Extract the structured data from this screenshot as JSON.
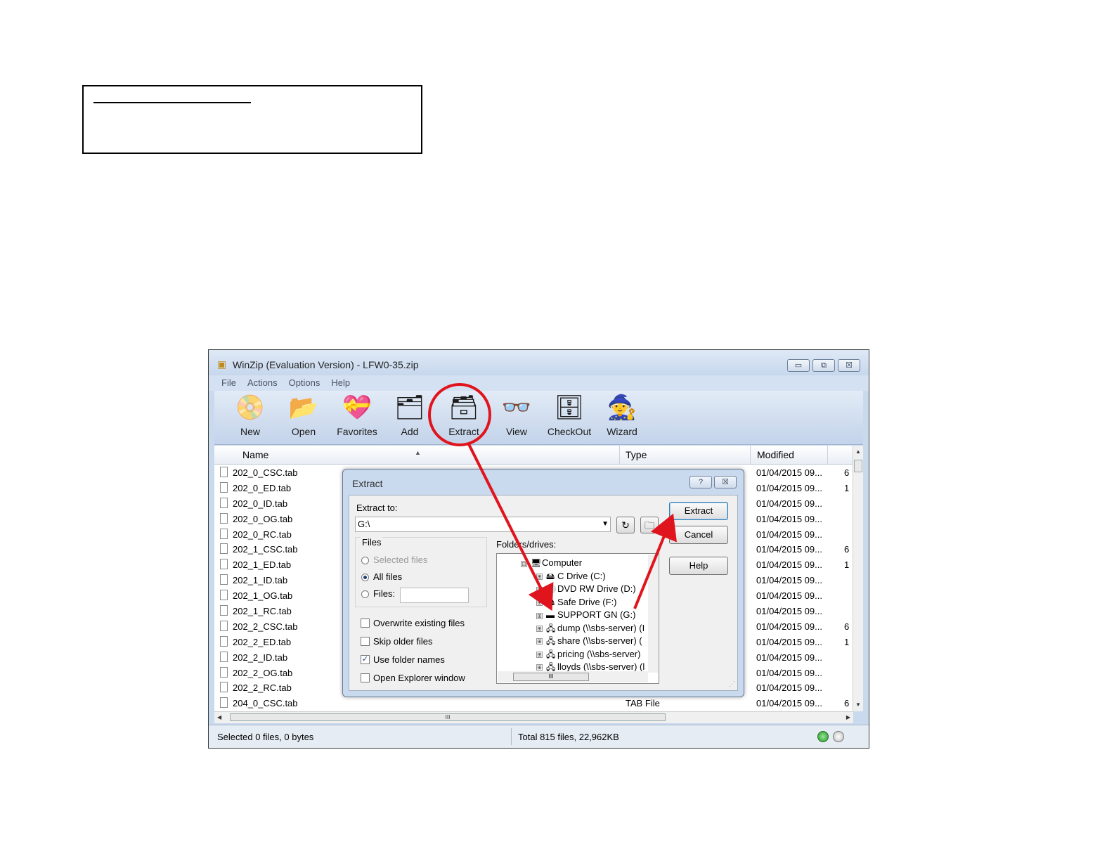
{
  "window": {
    "title": "WinZip (Evaluation Version) - LFW0-35.zip",
    "controls": [
      "▭",
      "⧉",
      "☒"
    ]
  },
  "menu": [
    "File",
    "Actions",
    "Options",
    "Help"
  ],
  "toolbar": [
    {
      "label": "New",
      "icon": "new-archive-icon",
      "glyph": "📀"
    },
    {
      "label": "Open",
      "icon": "open-archive-icon",
      "glyph": "📂"
    },
    {
      "label": "Favorites",
      "icon": "favorites-icon",
      "glyph": "💝"
    },
    {
      "label": "Add",
      "icon": "add-icon",
      "glyph": "🗂"
    },
    {
      "label": "Extract",
      "icon": "extract-icon",
      "glyph": "🗃"
    },
    {
      "label": "View",
      "icon": "view-icon",
      "glyph": "👓"
    },
    {
      "label": "CheckOut",
      "icon": "checkout-icon",
      "glyph": "🗄"
    },
    {
      "label": "Wizard",
      "icon": "wizard-icon",
      "glyph": "🧙"
    }
  ],
  "columns": {
    "name": "Name",
    "type": "Type",
    "modified": "Modified"
  },
  "files": [
    {
      "name": "202_0_CSC.tab",
      "type": "",
      "modified": "01/04/2015 09...",
      "extra": "6"
    },
    {
      "name": "202_0_ED.tab",
      "type": "",
      "modified": "01/04/2015 09...",
      "extra": "1"
    },
    {
      "name": "202_0_ID.tab",
      "type": "",
      "modified": "01/04/2015 09...",
      "extra": ""
    },
    {
      "name": "202_0_OG.tab",
      "type": "",
      "modified": "01/04/2015 09...",
      "extra": ""
    },
    {
      "name": "202_0_RC.tab",
      "type": "",
      "modified": "01/04/2015 09...",
      "extra": ""
    },
    {
      "name": "202_1_CSC.tab",
      "type": "",
      "modified": "01/04/2015 09...",
      "extra": "6"
    },
    {
      "name": "202_1_ED.tab",
      "type": "",
      "modified": "01/04/2015 09...",
      "extra": "1"
    },
    {
      "name": "202_1_ID.tab",
      "type": "",
      "modified": "01/04/2015 09...",
      "extra": ""
    },
    {
      "name": "202_1_OG.tab",
      "type": "",
      "modified": "01/04/2015 09...",
      "extra": ""
    },
    {
      "name": "202_1_RC.tab",
      "type": "",
      "modified": "01/04/2015 09...",
      "extra": ""
    },
    {
      "name": "202_2_CSC.tab",
      "type": "",
      "modified": "01/04/2015 09...",
      "extra": "6"
    },
    {
      "name": "202_2_ED.tab",
      "type": "",
      "modified": "01/04/2015 09...",
      "extra": "1"
    },
    {
      "name": "202_2_ID.tab",
      "type": "",
      "modified": "01/04/2015 09...",
      "extra": ""
    },
    {
      "name": "202_2_OG.tab",
      "type": "",
      "modified": "01/04/2015 09...",
      "extra": ""
    },
    {
      "name": "202_2_RC.tab",
      "type": "",
      "modified": "01/04/2015 09...",
      "extra": ""
    },
    {
      "name": "204_0_CSC.tab",
      "type": "TAB File",
      "modified": "01/04/2015 09...",
      "extra": "6"
    }
  ],
  "status": {
    "selected": "Selected 0 files, 0 bytes",
    "total": "Total 815 files, 22,962KB"
  },
  "dialog": {
    "title": "Extract",
    "help_glyph": "?",
    "close_glyph": "☒",
    "extract_to_label": "Extract to:",
    "path": "G:\\",
    "files_group": "Files",
    "selected_files": "Selected files",
    "all_files": "All files",
    "files_opt": "Files:",
    "overwrite": "Overwrite existing files",
    "skip_older": "Skip older files",
    "use_folder_names": "Use folder names",
    "open_explorer": "Open Explorer window",
    "folders_label": "Folders/drives:",
    "tree": [
      {
        "label": "Computer",
        "icon": "computer-icon",
        "glyph": "🖥",
        "expander": "⊟"
      },
      {
        "label": "C Drive (C:)",
        "icon": "hard-drive-icon",
        "glyph": "🖴",
        "expander": "⊞"
      },
      {
        "label": "DVD RW Drive (D:)",
        "icon": "dvd-drive-icon",
        "glyph": "💿",
        "expander": "⊞"
      },
      {
        "label": "Safe Drive (F:)",
        "icon": "drive-icon",
        "glyph": "🖴",
        "expander": "⊞"
      },
      {
        "label": "SUPPORT GN (G:)",
        "icon": "usb-drive-icon",
        "glyph": "▬",
        "expander": "⊞"
      },
      {
        "label": "dump (\\\\sbs-server) (I",
        "icon": "network-drive-icon",
        "glyph": "🖧",
        "expander": "⊞"
      },
      {
        "label": "share (\\\\sbs-server) (",
        "icon": "network-drive-icon",
        "glyph": "🖧",
        "expander": "⊞"
      },
      {
        "label": "pricing (\\\\sbs-server)",
        "icon": "network-drive-icon",
        "glyph": "🖧",
        "expander": "⊞"
      },
      {
        "label": "lloyds (\\\\sbs-server) (l",
        "icon": "network-drive-icon",
        "glyph": "🖧",
        "expander": "⊞"
      }
    ],
    "buttons": {
      "extract": "Extract",
      "cancel": "Cancel",
      "help": "Help"
    },
    "scroll_thumb_glyph": "III"
  },
  "annotation_color": "#e0141c"
}
